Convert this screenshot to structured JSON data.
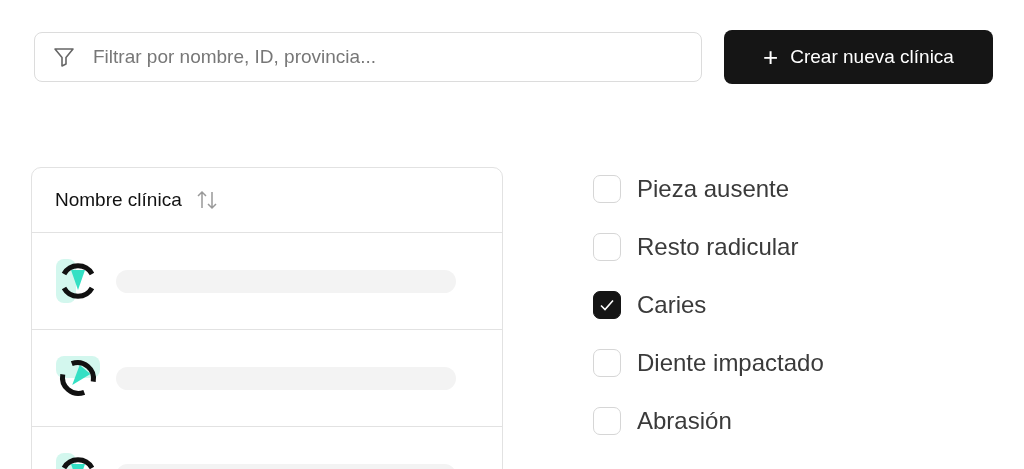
{
  "filter": {
    "placeholder": "Filtrar por nombre, ID, provincia..."
  },
  "create_button": {
    "icon": "+",
    "label": "Crear nueva clínica"
  },
  "table": {
    "columns": [
      {
        "label": "Nombre clínica"
      }
    ],
    "rows": [
      {
        "kind": "skeleton"
      },
      {
        "kind": "skeleton"
      },
      {
        "kind": "skeleton"
      }
    ]
  },
  "conditions": [
    {
      "label": "Pieza ausente",
      "checked": false
    },
    {
      "label": "Resto radicular",
      "checked": false
    },
    {
      "label": "Caries",
      "checked": true
    },
    {
      "label": "Diente impactado",
      "checked": false
    },
    {
      "label": "Abrasión",
      "checked": false
    }
  ]
}
